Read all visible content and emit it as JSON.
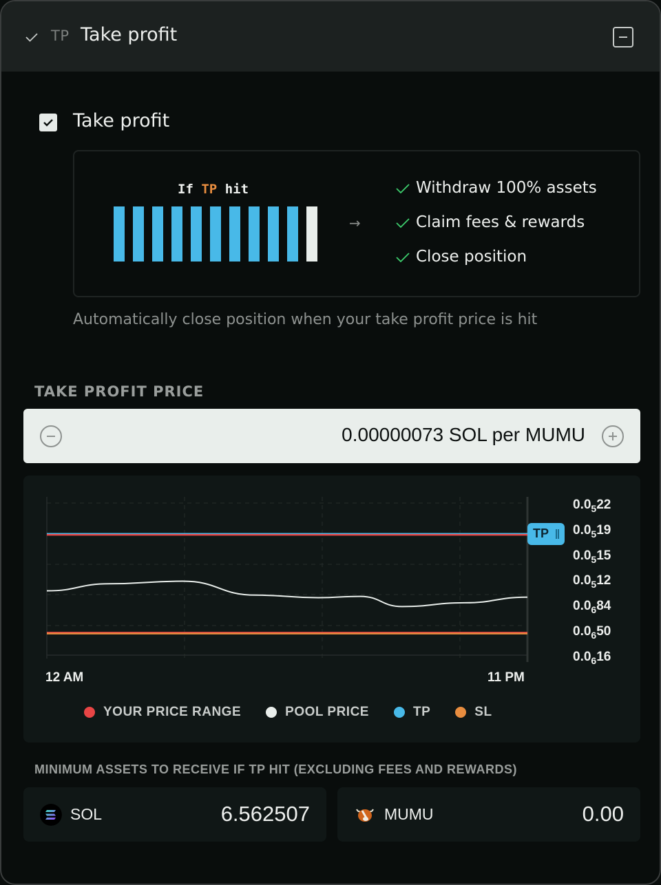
{
  "header": {
    "tag": "TP",
    "title": "Take profit",
    "check_icon": "check-icon",
    "collapse_icon": "minus-square-icon"
  },
  "take_profit": {
    "checkbox_checked": true,
    "label": "Take profit",
    "illustration": {
      "caption_prefix": "If",
      "caption_highlight": "TP",
      "caption_suffix": "hit",
      "bars": [
        {
          "color": "#48b9e8"
        },
        {
          "color": "#48b9e8"
        },
        {
          "color": "#48b9e8"
        },
        {
          "color": "#48b9e8"
        },
        {
          "color": "#48b9e8"
        },
        {
          "color": "#48b9e8"
        },
        {
          "color": "#48b9e8"
        },
        {
          "color": "#48b9e8"
        },
        {
          "color": "#48b9e8"
        },
        {
          "color": "#48b9e8"
        },
        {
          "color": "#e9eeeb"
        }
      ],
      "arrow_icon": "arrow-right-icon"
    },
    "outcomes": [
      "Withdraw 100% assets",
      "Claim fees & rewards",
      "Close position"
    ],
    "description": "Automatically close position when your take profit price is hit"
  },
  "price": {
    "label": "TAKE PROFIT PRICE",
    "value": "0.00000073 SOL per MUMU",
    "decrement_icon": "minus-circle-icon",
    "increment_icon": "plus-circle-icon"
  },
  "chart_data": {
    "type": "line",
    "title": "",
    "x_tick_labels": [
      "12 AM",
      "11 PM"
    ],
    "y_tick_labels": [
      {
        "base": "0.0",
        "sub": "5",
        "digits": "22"
      },
      {
        "base": "0.0",
        "sub": "5",
        "digits": "19"
      },
      {
        "base": "0.0",
        "sub": "5",
        "digits": "15"
      },
      {
        "base": "0.0",
        "sub": "5",
        "digits": "12"
      },
      {
        "base": "0.0",
        "sub": "6",
        "digits": "84"
      },
      {
        "base": "0.0",
        "sub": "6",
        "digits": "50"
      },
      {
        "base": "0.0",
        "sub": "6",
        "digits": "16"
      }
    ],
    "y_tick_values": [
      2.2e-06,
      1.9e-06,
      1.5e-06,
      1.2e-06,
      8.4e-07,
      5e-07,
      1.6e-07
    ],
    "y_tick_index_range": [
      0,
      6
    ],
    "x_range": [
      0,
      23
    ],
    "grid": true,
    "series": [
      {
        "name": "POOL PRICE",
        "color": "#e9eeeb",
        "x": [
          0,
          3,
          6.5,
          10,
          13,
          15,
          17,
          20,
          23
        ],
        "y_index": [
          3.33,
          3.05,
          2.95,
          3.5,
          3.6,
          3.55,
          3.95,
          3.8,
          3.58
        ]
      },
      {
        "name": "TP",
        "color": "#48b9e8",
        "y_index": 1.08,
        "handle_label": "TP"
      },
      {
        "name": "YOUR PRICE RANGE upper",
        "color": "#e84545",
        "y_index": 1.12
      },
      {
        "name": "YOUR PRICE RANGE lower",
        "color": "#e84545",
        "y_index": 4.98
      },
      {
        "name": "SL",
        "color": "#e88d3f",
        "y_index": 5.02
      }
    ],
    "legend": [
      {
        "label": "YOUR PRICE RANGE",
        "color": "#e84545"
      },
      {
        "label": "POOL PRICE",
        "color": "#e9eeeb"
      },
      {
        "label": "TP",
        "color": "#48b9e8"
      },
      {
        "label": "SL",
        "color": "#e88d3f"
      }
    ],
    "legend_position": "bottom"
  },
  "min_assets": {
    "label": "MINIMUM ASSETS TO RECEIVE IF TP HIT (EXCLUDING FEES AND REWARDS)",
    "assets": [
      {
        "symbol": "SOL",
        "amount": "6.562507",
        "icon": "solana-logo-icon"
      },
      {
        "symbol": "MUMU",
        "amount": "0.00",
        "icon": "mumu-bull-logo-icon"
      }
    ]
  }
}
